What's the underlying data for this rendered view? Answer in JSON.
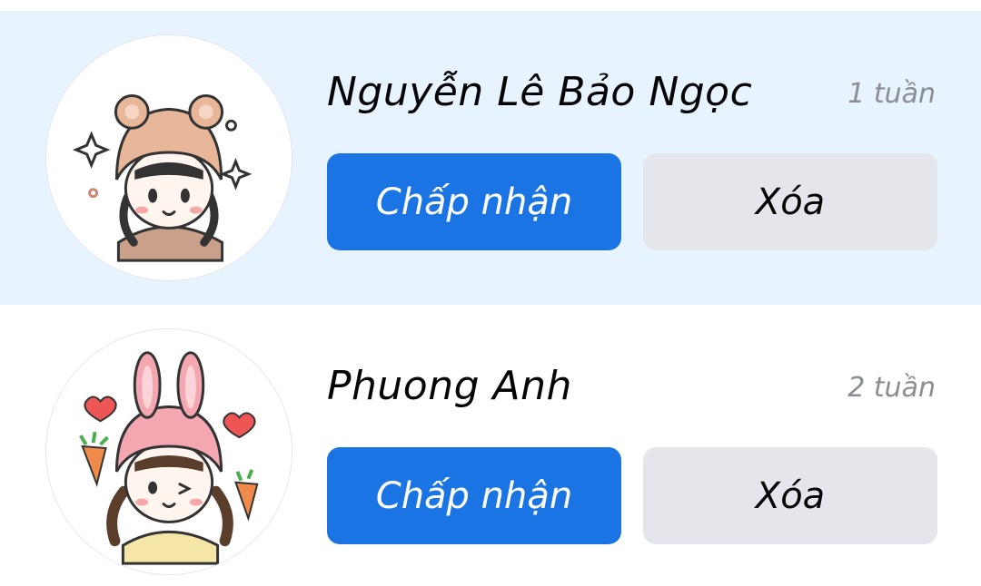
{
  "requests": [
    {
      "name": "Nguyễn Lê Bảo Ngọc",
      "time": "1 tuần",
      "accept_label": "Chấp nhận",
      "delete_label": "Xóa",
      "avatar_icon": "bear-hat-girl-avatar"
    },
    {
      "name": "Phuong Anh",
      "time": "2 tuần",
      "accept_label": "Chấp nhận",
      "delete_label": "Xóa",
      "avatar_icon": "bunny-hat-girl-avatar"
    }
  ],
  "colors": {
    "highlight_bg": "#e7f3ff",
    "accept_bg": "#1b74e4",
    "delete_bg": "#e4e6eb",
    "time_text": "#8a8d91"
  }
}
